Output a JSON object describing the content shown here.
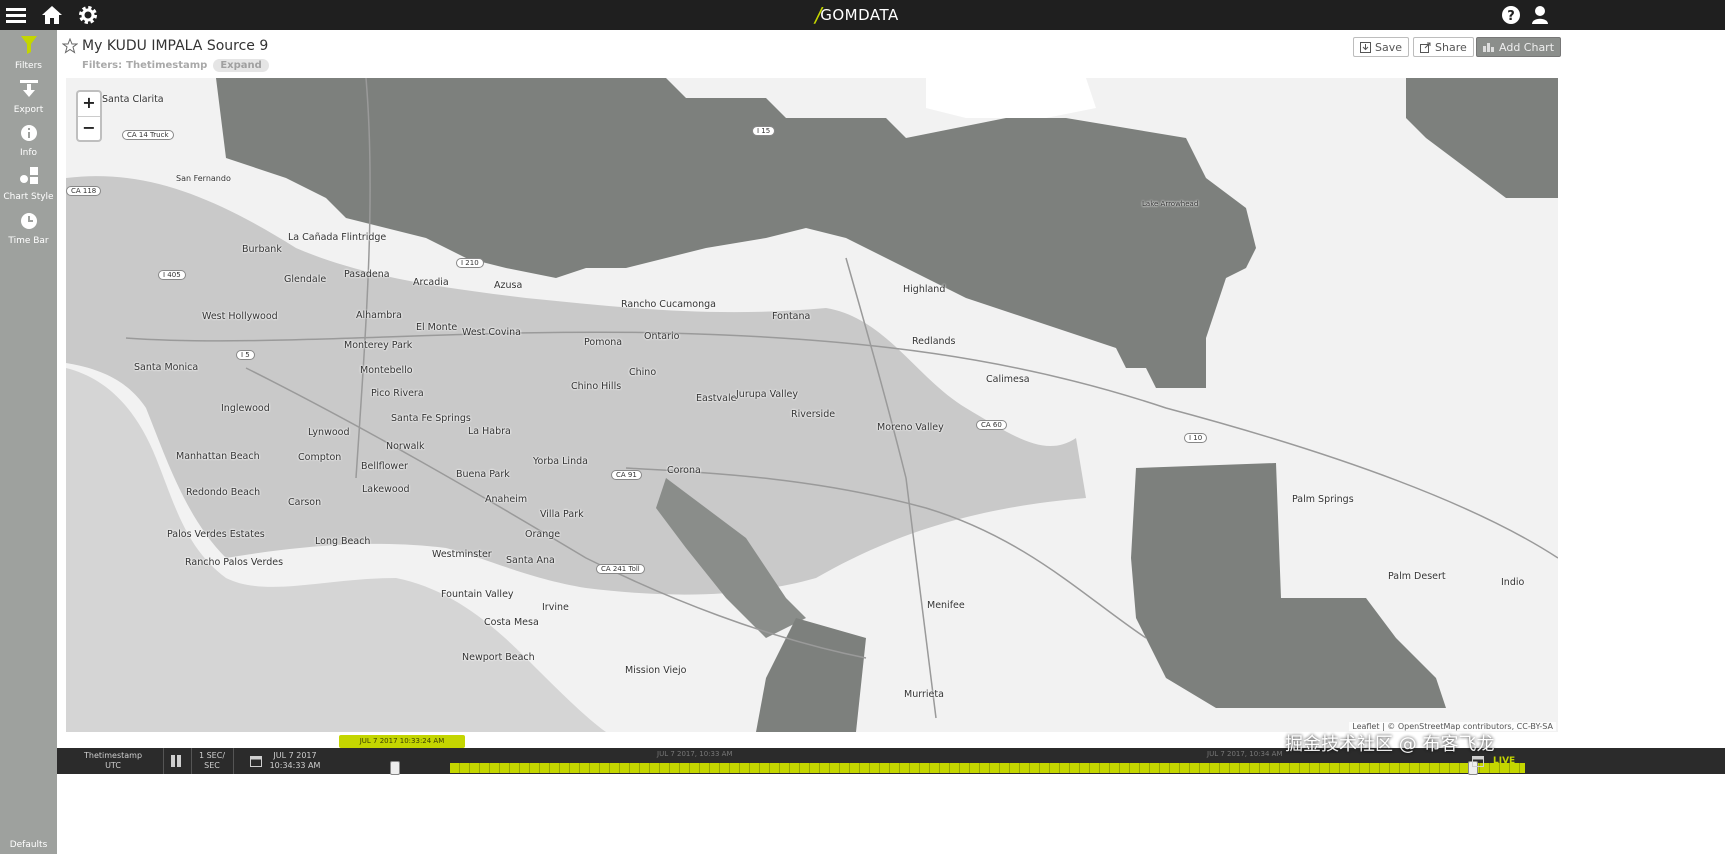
{
  "topbar": {
    "brand": "GOMDATA",
    "icons": [
      "menu-icon",
      "home-icon",
      "gear-icon",
      "help-icon",
      "user-icon"
    ]
  },
  "sidebar": {
    "items": [
      {
        "label": "Filters",
        "icon": "filter-icon",
        "active": true
      },
      {
        "label": "Export",
        "icon": "export-icon"
      },
      {
        "label": "Info",
        "icon": "info-icon"
      },
      {
        "label": "Chart Style",
        "icon": "chart-style-icon"
      },
      {
        "label": "Time Bar",
        "icon": "clock-icon"
      }
    ],
    "defaults_label": "Defaults"
  },
  "header": {
    "title": "My KUDU IMPALA Source 9",
    "filters_label": "Filters:",
    "filters_value": "Thetimestamp",
    "expand_label": "Expand",
    "save_label": "Save",
    "share_label": "Share",
    "add_chart_label": "Add Chart"
  },
  "map": {
    "zoom_in": "+",
    "zoom_out": "−",
    "attribution": "Leaflet | © OpenStreetMap contributors, CC-BY-SA",
    "places": [
      "Santa Clarita",
      "San Fernando",
      "Burbank",
      "La Cañada Flintridge",
      "Glendale",
      "Pasadena",
      "Arcadia",
      "Azusa",
      "West Hollywood",
      "Alhambra",
      "El Monte",
      "West Covina",
      "Rancho Cucamonga",
      "Fontana",
      "Highland",
      "Redlands",
      "Santa Monica",
      "Monterey Park",
      "Montebello",
      "Pomona",
      "Ontario",
      "Pico Rivera",
      "Santa Fe Springs",
      "Chino Hills",
      "Chino",
      "Eastvale",
      "Jurupa Valley",
      "Riverside",
      "Calimesa",
      "Inglewood",
      "Lynwood",
      "La Habra",
      "Moreno Valley",
      "Norwalk",
      "Manhattan Beach",
      "Compton",
      "Bellflower",
      "Buena Park",
      "Yorba Linda",
      "Corona",
      "Lakewood",
      "Redondo Beach",
      "Carson",
      "Anaheim",
      "Villa Park",
      "Palm Springs",
      "Palos Verdes Estates",
      "Long Beach",
      "Orange",
      "Rancho Palos Verdes",
      "Westminster",
      "Santa Ana",
      "Palm Desert",
      "Indio",
      "Fountain Valley",
      "Irvine",
      "Menifee",
      "Costa Mesa",
      "Newport Beach",
      "Mission Viejo",
      "Murrieta",
      "Lake Arrowhead"
    ],
    "shields": [
      "CA 14 Truck",
      "CA 118",
      "I 405",
      "I 5",
      "I 210",
      "I 15",
      "I 10",
      "CA 60",
      "CA 91",
      "CA 241 Toll"
    ]
  },
  "timebar": {
    "chip_label": "JUL 7 2017 10:33:24 AM",
    "field_name": "Thetimestamp",
    "field_tz": "UTC",
    "rate_top": "1 SEC/",
    "rate_bottom": "SEC",
    "date": "JUL 7 2017",
    "time": "10:34:33 AM",
    "scale_left": "JUL 7 2017, 10:33 AM",
    "scale_right": "JUL 7 2017, 10:34 AM",
    "live_label": "LIVE"
  },
  "watermark": "掘金技术社区 @ 布客飞龙",
  "colors": {
    "accent": "#c4d600",
    "topbar": "#1f1f1f",
    "sidebar": "#9ea19e",
    "land_dark": "#7d807d",
    "land_light": "#f2f2f2",
    "ocean": "#d5d5d5"
  }
}
